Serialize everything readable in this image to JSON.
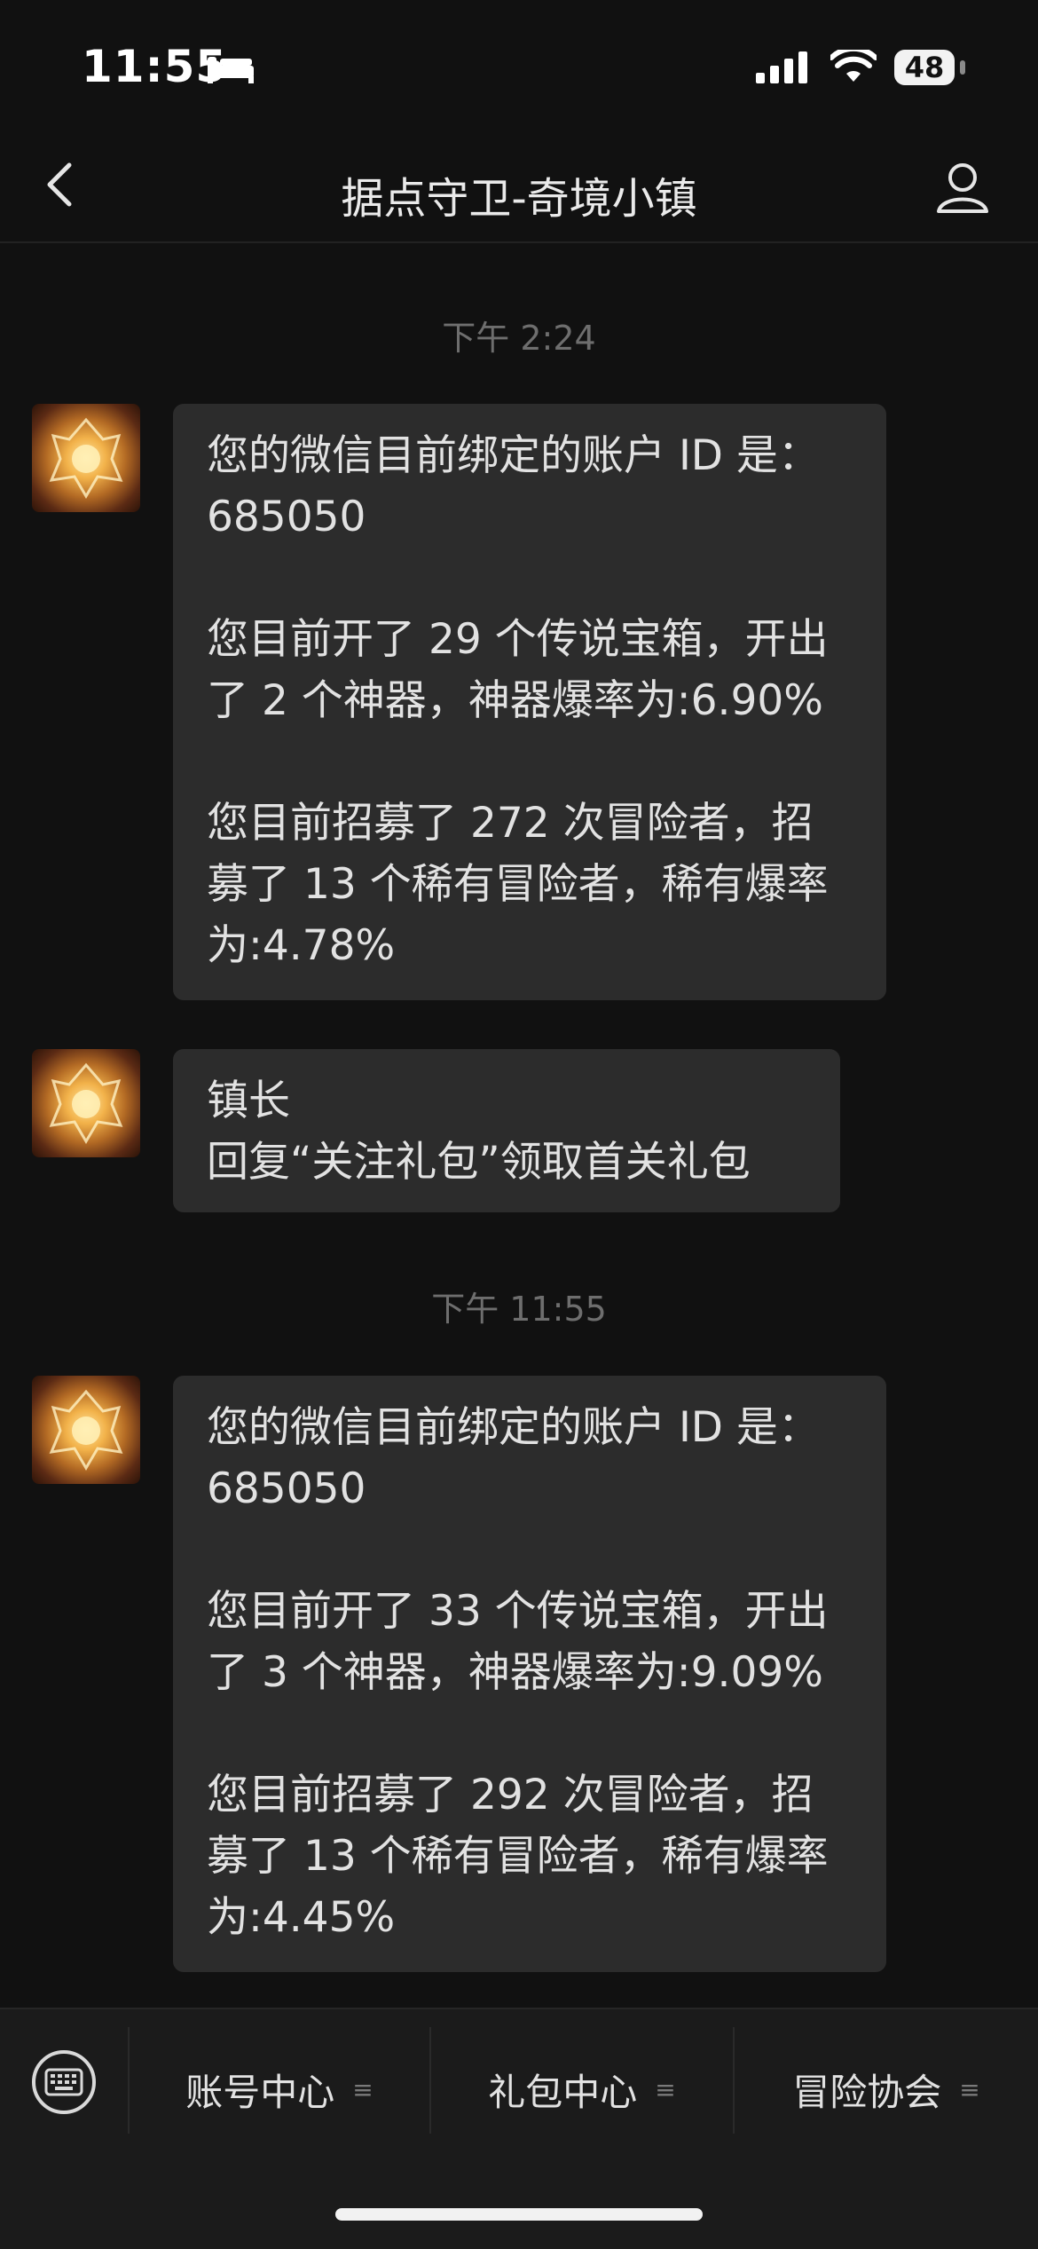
{
  "status_bar": {
    "time": "11:55",
    "battery": "48"
  },
  "nav": {
    "title": "据点守卫-奇境小镇"
  },
  "timestamps": [
    "下午 2:24",
    "下午 11:55"
  ],
  "messages": [
    {
      "text": "您的微信目前绑定的账户 ID 是：\n685050\n\n您目前开了 29 个传说宝箱，开出\n了 2 个神器，神器爆率为:6.90%\n\n您目前招募了 272 次冒险者，招\n募了 13 个稀有冒险者，稀有爆率\n为:4.78%"
    },
    {
      "text": "镇长\n回复“关注礼包”领取首关礼包"
    },
    {
      "text": "您的微信目前绑定的账户 ID 是：\n685050\n\n您目前开了 33 个传说宝箱，开出\n了 3 个神器，神器爆率为:9.09%\n\n您目前招募了 292 次冒险者，招\n募了 13 个稀有冒险者，稀有爆率\n为:4.45%"
    }
  ],
  "menu": {
    "items": [
      {
        "label": "账号中心",
        "icon": "menu-lines-icon"
      },
      {
        "label": "礼包中心",
        "icon": "menu-lines-icon"
      },
      {
        "label": "冒险协会",
        "icon": "menu-lines-icon"
      }
    ],
    "lines_glyph": "≡"
  },
  "colors": {
    "background": "#111111",
    "bubble": "#2c2c2c",
    "text": "#e2e2e2",
    "timestamp": "#6e6e6e"
  }
}
